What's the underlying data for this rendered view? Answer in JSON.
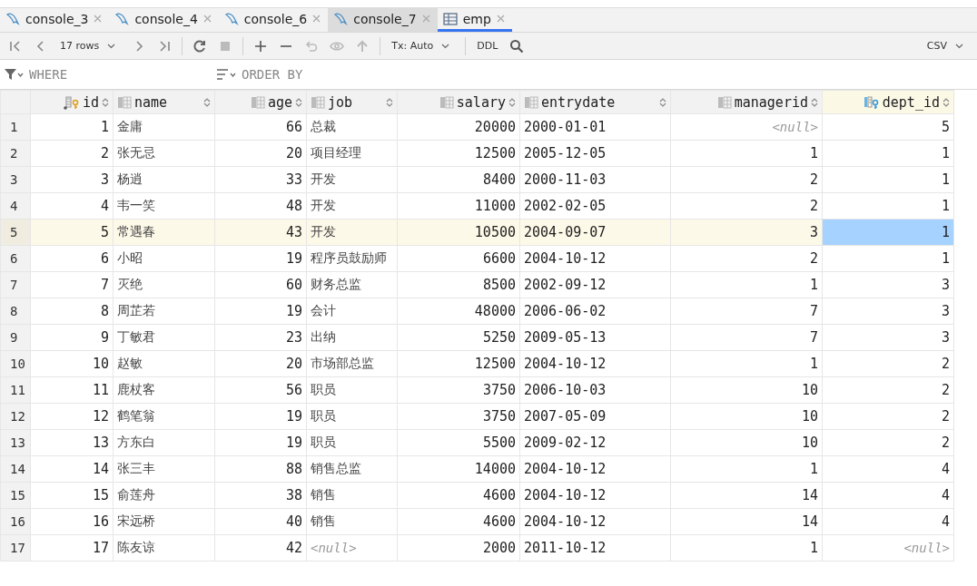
{
  "tabs": [
    {
      "label": "console_3",
      "kind": "console",
      "selected": false,
      "hovered": false
    },
    {
      "label": "console_4",
      "kind": "console",
      "selected": false,
      "hovered": false
    },
    {
      "label": "console_6",
      "kind": "console",
      "selected": false,
      "hovered": false
    },
    {
      "label": "console_7",
      "kind": "console",
      "selected": false,
      "hovered": true
    },
    {
      "label": "emp",
      "kind": "table",
      "selected": true,
      "hovered": false
    }
  ],
  "toolbar": {
    "rows": "17 rows",
    "tx": "Tx: Auto",
    "ddl": "DDL",
    "export": "CSV"
  },
  "filter": {
    "where_placeholder": "WHERE",
    "order_placeholder": "ORDER BY"
  },
  "table": {
    "columns": [
      {
        "name": "id",
        "kind": "primary",
        "current": false
      },
      {
        "name": "name",
        "kind": "text",
        "current": false
      },
      {
        "name": "age",
        "kind": "number",
        "current": false
      },
      {
        "name": "job",
        "kind": "text",
        "current": false
      },
      {
        "name": "salary",
        "kind": "number",
        "current": false
      },
      {
        "name": "entrydate",
        "kind": "text",
        "current": false
      },
      {
        "name": "managerid",
        "kind": "number",
        "current": false
      },
      {
        "name": "dept_id",
        "kind": "foreign",
        "current": true
      }
    ],
    "rows": [
      {
        "number": "1",
        "selected": false,
        "cells": [
          "1",
          "金庸",
          "66",
          "总裁",
          "20000",
          "2000-01-01",
          {
            "text": "<null>",
            "null": true
          },
          "5"
        ]
      },
      {
        "number": "2",
        "selected": false,
        "cells": [
          "2",
          "张无忌",
          "20",
          "项目经理",
          "12500",
          "2005-12-05",
          "1",
          "1"
        ]
      },
      {
        "number": "3",
        "selected": false,
        "cells": [
          "3",
          "杨逍",
          "33",
          "开发",
          "8400",
          "2000-11-03",
          "2",
          "1"
        ]
      },
      {
        "number": "4",
        "selected": false,
        "cells": [
          "4",
          "韦一笑",
          "48",
          "开发",
          "11000",
          "2002-02-05",
          "2",
          "1"
        ]
      },
      {
        "number": "5",
        "selected": true,
        "cells": [
          "5",
          "常遇春",
          "43",
          "开发",
          "10500",
          "2004-09-07",
          "3",
          {
            "text": "1",
            "selected": true
          }
        ]
      },
      {
        "number": "6",
        "selected": false,
        "cells": [
          "6",
          "小昭",
          "19",
          "程序员鼓励师",
          "6600",
          "2004-10-12",
          "2",
          "1"
        ]
      },
      {
        "number": "7",
        "selected": false,
        "cells": [
          "7",
          "灭绝",
          "60",
          "财务总监",
          "8500",
          "2002-09-12",
          "1",
          "3"
        ]
      },
      {
        "number": "8",
        "selected": false,
        "cells": [
          "8",
          "周芷若",
          "19",
          "会计",
          "48000",
          "2006-06-02",
          "7",
          "3"
        ]
      },
      {
        "number": "9",
        "selected": false,
        "cells": [
          "9",
          "丁敏君",
          "23",
          "出纳",
          "5250",
          "2009-05-13",
          "7",
          "3"
        ]
      },
      {
        "number": "10",
        "selected": false,
        "cells": [
          "10",
          "赵敏",
          "20",
          "市场部总监",
          "12500",
          "2004-10-12",
          "1",
          "2"
        ]
      },
      {
        "number": "11",
        "selected": false,
        "cells": [
          "11",
          "鹿杖客",
          "56",
          "职员",
          "3750",
          "2006-10-03",
          "10",
          "2"
        ]
      },
      {
        "number": "12",
        "selected": false,
        "cells": [
          "12",
          "鹤笔翁",
          "19",
          "职员",
          "3750",
          "2007-05-09",
          "10",
          "2"
        ]
      },
      {
        "number": "13",
        "selected": false,
        "cells": [
          "13",
          "方东白",
          "19",
          "职员",
          "5500",
          "2009-02-12",
          "10",
          "2"
        ]
      },
      {
        "number": "14",
        "selected": false,
        "cells": [
          "14",
          "张三丰",
          "88",
          "销售总监",
          "14000",
          "2004-10-12",
          "1",
          "4"
        ]
      },
      {
        "number": "15",
        "selected": false,
        "cells": [
          "15",
          "俞莲舟",
          "38",
          "销售",
          "4600",
          "2004-10-12",
          "14",
          "4"
        ]
      },
      {
        "number": "16",
        "selected": false,
        "cells": [
          "16",
          "宋远桥",
          "40",
          "销售",
          "4600",
          "2004-10-12",
          "14",
          "4"
        ]
      },
      {
        "number": "17",
        "selected": false,
        "cells": [
          "17",
          "陈友谅",
          "42",
          {
            "text": "<null>",
            "null": true
          },
          "2000",
          "2011-10-12",
          "1",
          {
            "text": "<null>",
            "null": true
          }
        ]
      }
    ]
  }
}
